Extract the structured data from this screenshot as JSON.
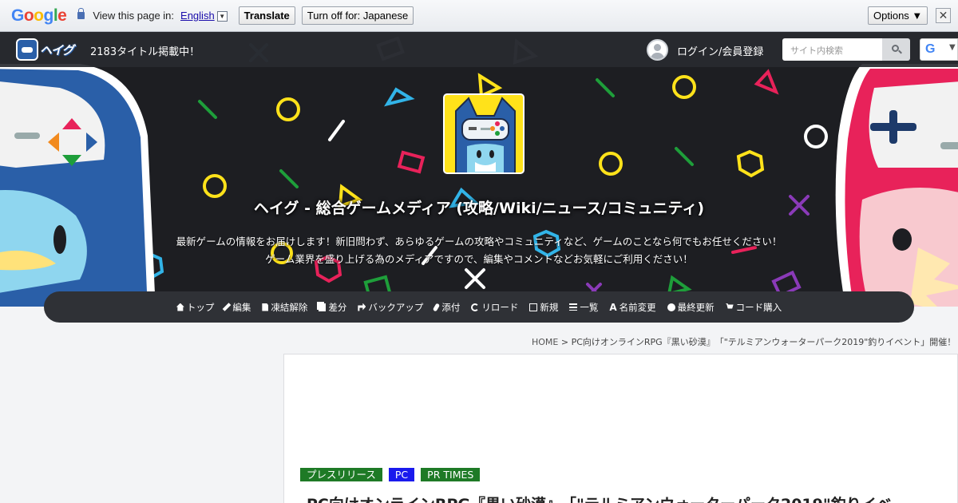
{
  "translate_bar": {
    "logo": "Google",
    "view_text": "View this page in:",
    "language": "English",
    "dropdown_glyph": "▼",
    "translate_button": "Translate",
    "turn_off_button": "Turn off for: Japanese",
    "options_button": "Options ▼",
    "close_glyph": "✕"
  },
  "header": {
    "logo_text": "ヘイグ",
    "title_count": "2183タイトル掲載中！",
    "login_text": "ログイン/会員登録",
    "search_placeholder": "サイト内検索",
    "google_glyph": "G",
    "google_arrow": "▼"
  },
  "hero": {
    "title": "ヘイグ - 総合ゲームメディア (攻略/Wiki/ニュース/コミュニティ)",
    "desc_line1": "最新ゲームの情報をお届けします！新旧問わず、あらゆるゲームの攻略やコミュニティなど、ゲームのことなら何でもお任せください！",
    "desc_line2": "ゲーム業界を盛り上げる為のメディアですので、編集やコメントなどお気軽にご利用ください！"
  },
  "nav": {
    "items": [
      {
        "label": "トップ",
        "icon": "home-icon"
      },
      {
        "label": "編集",
        "icon": "pencil-icon"
      },
      {
        "label": "凍結解除",
        "icon": "document-icon"
      },
      {
        "label": "差分",
        "icon": "copy-icon"
      },
      {
        "label": "バックアップ",
        "icon": "share-icon"
      },
      {
        "label": "添付",
        "icon": "paperclip-icon"
      },
      {
        "label": "リロード",
        "icon": "refresh-icon"
      },
      {
        "label": "新規",
        "icon": "edit-icon"
      },
      {
        "label": "一覧",
        "icon": "list-icon"
      },
      {
        "label": "名前変更",
        "icon": "font-icon"
      },
      {
        "label": "最終更新",
        "icon": "clock-icon"
      },
      {
        "label": "コード購入",
        "icon": "cart-icon"
      }
    ]
  },
  "breadcrumb": {
    "home": "HOME",
    "sep": " > ",
    "current": "PC向けオンラインRPG『黒い砂漠』　「\"テルミアンウォーターパーク2019\"釣りイベント」開催！"
  },
  "article": {
    "tags": [
      "プレスリリース",
      "PC",
      "PR TIMES"
    ],
    "title": "PC向けオンラインRPG『黒い砂漠』　「\"テルミアンウォーターパーク2019\"釣りイベ"
  },
  "colors": {
    "hero_bg": "#1d1e22",
    "tag_green": "#1e7a26",
    "tag_blue": "#1a1aed",
    "mascot_blue": "#2a5fa8",
    "mascot_pink": "#e8225a",
    "icon_yellow": "#ffe21a"
  }
}
